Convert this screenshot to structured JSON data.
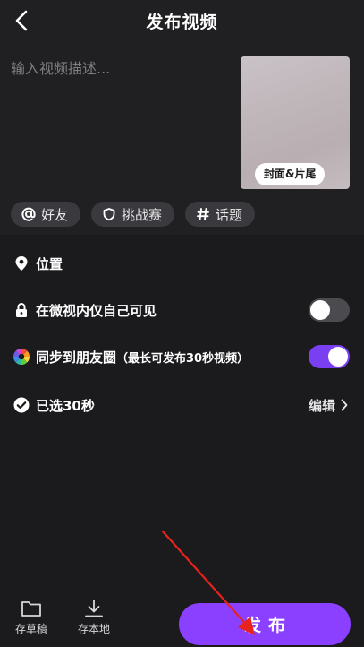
{
  "header": {
    "title": "发布视频",
    "back_icon": "chevron-left-icon"
  },
  "compose": {
    "placeholder": "输入视频描述...",
    "cover_button": "封面&片尾"
  },
  "chips": [
    {
      "icon": "at-icon",
      "label": "好友"
    },
    {
      "icon": "shield-icon",
      "label": "挑战赛"
    },
    {
      "icon": "hashtag-icon",
      "label": "话题"
    }
  ],
  "options": {
    "location": {
      "icon": "location-pin-icon",
      "label": "位置"
    },
    "private": {
      "icon": "lock-icon",
      "label": "在微视内仅自己可见",
      "enabled": false
    },
    "sync": {
      "icon": "moments-icon",
      "label": "同步到朋友圈",
      "note": "（最长可发布30秒视频）",
      "enabled": true
    },
    "selected": {
      "icon": "check-circle-icon",
      "label": "已选30秒",
      "action": "编辑"
    }
  },
  "bottom": {
    "draft_label": "存草稿",
    "local_label": "存本地",
    "publish_label": "发布"
  },
  "colors": {
    "accent": "#8b3fff",
    "background": "#1b1b1d",
    "arrow": "#e8231c"
  }
}
